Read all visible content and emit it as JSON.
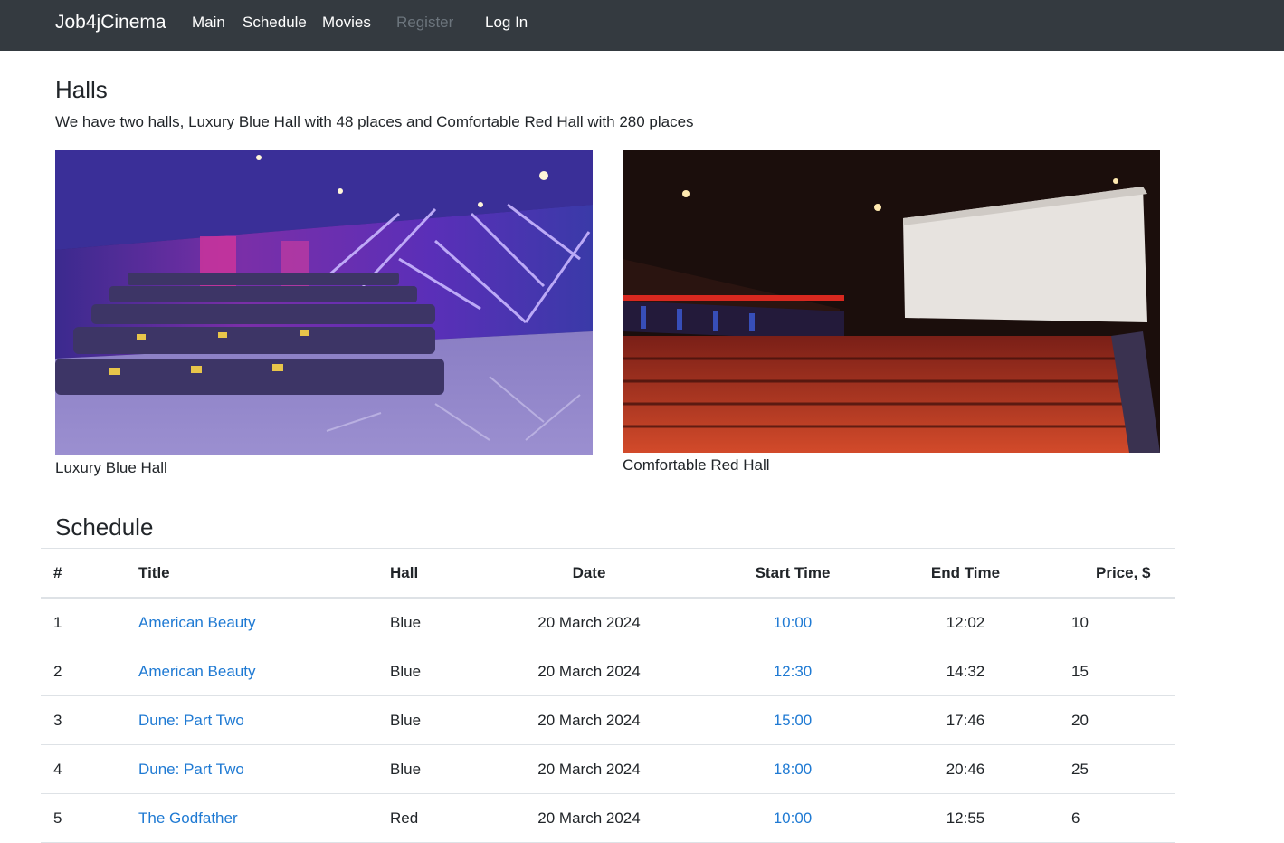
{
  "nav": {
    "brand": "Job4jCinema",
    "main": "Main",
    "schedule": "Schedule",
    "movies": "Movies",
    "register": "Register",
    "login": "Log In"
  },
  "halls": {
    "heading": "Halls",
    "description": "We have two halls, Luxury Blue Hall with 48 places and Comfortable Red Hall with 280 places",
    "items": [
      {
        "caption": "Luxury Blue Hall"
      },
      {
        "caption": "Comfortable Red Hall"
      }
    ]
  },
  "schedule": {
    "heading": "Schedule",
    "columns": [
      "#",
      "Title",
      "Hall",
      "Date",
      "Start Time",
      "End Time",
      "Price, $"
    ],
    "rows": [
      {
        "num": "1",
        "title": "American Beauty",
        "hall": "Blue",
        "date": "20 March 2024",
        "start": "10:00",
        "end": "12:02",
        "price": "10"
      },
      {
        "num": "2",
        "title": "American Beauty",
        "hall": "Blue",
        "date": "20 March 2024",
        "start": "12:30",
        "end": "14:32",
        "price": "15"
      },
      {
        "num": "3",
        "title": "Dune: Part Two",
        "hall": "Blue",
        "date": "20 March 2024",
        "start": "15:00",
        "end": "17:46",
        "price": "20"
      },
      {
        "num": "4",
        "title": "Dune: Part Two",
        "hall": "Blue",
        "date": "20 March 2024",
        "start": "18:00",
        "end": "20:46",
        "price": "25"
      },
      {
        "num": "5",
        "title": "The Godfather",
        "hall": "Red",
        "date": "20 March 2024",
        "start": "10:00",
        "end": "12:55",
        "price": "6"
      }
    ]
  },
  "colors": {
    "navbar": "#343a40",
    "link": "#1f7ad3",
    "disabled": "#6c757d"
  }
}
